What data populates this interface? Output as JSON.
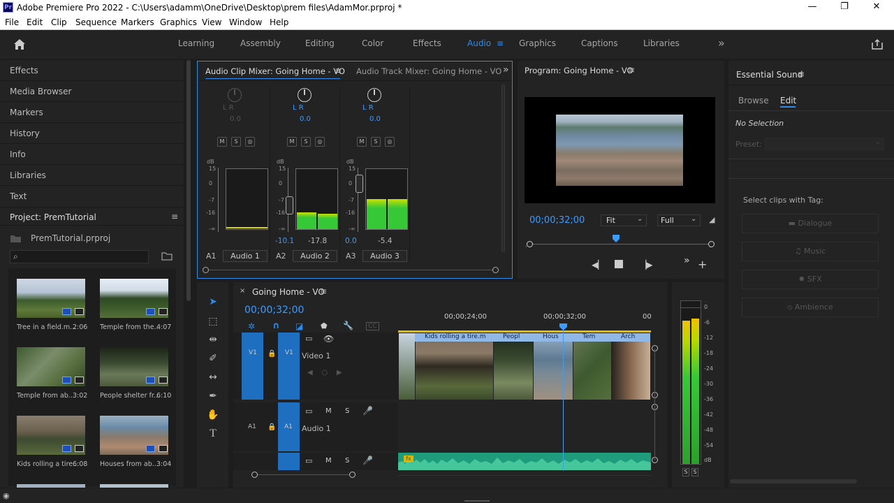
{
  "titlebar": {
    "logo": "Pr",
    "title": "Adobe Premiere Pro 2022 - C:\\Users\\adamm\\OneDrive\\Desktop\\prem files\\AdamMor.prproj *",
    "minimize": "—",
    "restore": "❐",
    "close": "✕"
  },
  "menu": [
    "File",
    "Edit",
    "Clip",
    "Sequence",
    "Markers",
    "Graphics",
    "View",
    "Window",
    "Help"
  ],
  "workspaces": {
    "tabs": [
      "Learning",
      "Assembly",
      "Editing",
      "Color",
      "Effects",
      "Audio",
      "Graphics",
      "Captions",
      "Libraries"
    ],
    "active": "Audio",
    "more": "»"
  },
  "left_panels": [
    "Effects",
    "Media Browser",
    "Markers",
    "History",
    "Info",
    "Libraries",
    "Text"
  ],
  "project": {
    "title": "Project: PremTutorial",
    "file": "PremTutorial.prproj",
    "search_placeholder": "",
    "items": [
      {
        "name": "Tree in a field.m...",
        "dur": "2:06"
      },
      {
        "name": "Temple from the...",
        "dur": "4:07"
      },
      {
        "name": "Temple from ab...",
        "dur": "3:02"
      },
      {
        "name": "People shelter fr...",
        "dur": "6:10"
      },
      {
        "name": "Kids rolling a tire...",
        "dur": "6:08"
      },
      {
        "name": "Houses from ab...",
        "dur": "3:04"
      }
    ]
  },
  "mixer": {
    "tab_active": "Audio Clip Mixer: Going Home - VO",
    "tab_inactive": "Audio Track Mixer: Going Home - VO",
    "channels": [
      {
        "lr": "L R",
        "pan": "0.0",
        "ch": "A1",
        "name": "Audio 1",
        "gain": "",
        "peak": "",
        "level": 0.02
      },
      {
        "lr": "L R",
        "pan": "0.0",
        "ch": "A2",
        "name": "Audio 2",
        "gain": "-10.1",
        "peak": "-17.8",
        "level": 0.28
      },
      {
        "lr": "L R",
        "pan": "0.0",
        "ch": "A3",
        "name": "Audio 3",
        "gain": "0.0",
        "peak": "-5.4",
        "level": 0.5
      }
    ],
    "db_ticks": [
      "dB",
      "15",
      "0",
      "-7",
      "-16",
      "-∞"
    ],
    "m": "M",
    "s": "S"
  },
  "program": {
    "title": "Program: Going Home - VO",
    "timecode": "00;00;32;00",
    "fit": "Fit",
    "quality": "Full"
  },
  "essential": {
    "title": "Essential Sound",
    "tabs": [
      "Browse",
      "Edit"
    ],
    "active_tab": "Edit",
    "selection": "No Selection",
    "preset_label": "Preset:",
    "tag_label": "Select clips with Tag:",
    "buttons": [
      "Dialogue",
      "Music",
      "SFX",
      "Ambience"
    ]
  },
  "timeline": {
    "title": "Going Home - VO",
    "timecode": "00;00;32;00",
    "ruler": [
      "00;00;24;00",
      "00;00;32;00",
      "00"
    ],
    "v1": {
      "src": "V1",
      "tgt": "V1",
      "name": "Video 1"
    },
    "a1": {
      "src": "A1",
      "tgt": "A1",
      "name": "Audio 1",
      "m": "M",
      "s": "S"
    },
    "a2": {
      "m": "M",
      "s": "S"
    },
    "clips": [
      "Kids rolling a tire.m",
      "Peopl",
      "Hous",
      "Tem",
      "Arch"
    ],
    "fx": "fx"
  },
  "vu": {
    "ticks": [
      "0",
      "-6",
      "-12",
      "-18",
      "-24",
      "-30",
      "-36",
      "-42",
      "-48",
      "-54",
      "dB"
    ],
    "s1": "S",
    "s2": "S"
  },
  "colors": {
    "accent": "#2d8ceb",
    "meter_green": "#37c837",
    "audio_clip": "#1f9c7c",
    "clip_label": "#8fb8e6"
  }
}
